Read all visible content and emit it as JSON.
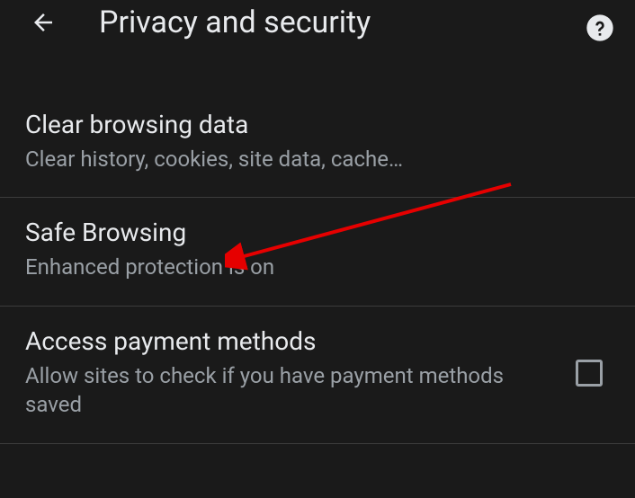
{
  "header": {
    "title": "Privacy and security"
  },
  "settings": {
    "clearBrowsing": {
      "title": "Clear browsing data",
      "subtitle": "Clear history, cookies, site data, cache…"
    },
    "safeBrowsing": {
      "title": "Safe Browsing",
      "subtitle": "Enhanced protection is on"
    },
    "paymentMethods": {
      "title": "Access payment methods",
      "subtitle": "Allow sites to check if you have payment methods saved",
      "checked": false
    }
  }
}
